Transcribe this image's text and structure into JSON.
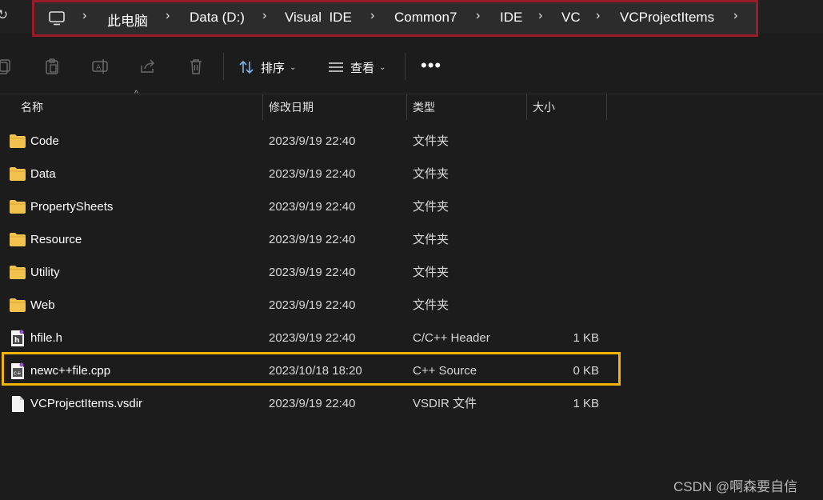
{
  "address_bar": {
    "crumbs": [
      "此电脑",
      "Data (D:)",
      "Visual  IDE",
      "Common7",
      "IDE",
      "VC",
      "VCProjectItems"
    ]
  },
  "toolbar": {
    "sort_label": "排序",
    "view_label": "查看",
    "more_label": "•••"
  },
  "columns": {
    "name": "名称",
    "date": "修改日期",
    "type": "类型",
    "size": "大小"
  },
  "files": [
    {
      "name": "Code",
      "date": "2023/9/19 22:40",
      "type": "文件夹",
      "size": "",
      "icon": "folder-icon"
    },
    {
      "name": "Data",
      "date": "2023/9/19 22:40",
      "type": "文件夹",
      "size": "",
      "icon": "folder-icon"
    },
    {
      "name": "PropertySheets",
      "date": "2023/9/19 22:40",
      "type": "文件夹",
      "size": "",
      "icon": "folder-icon"
    },
    {
      "name": "Resource",
      "date": "2023/9/19 22:40",
      "type": "文件夹",
      "size": "",
      "icon": "folder-icon"
    },
    {
      "name": "Utility",
      "date": "2023/9/19 22:40",
      "type": "文件夹",
      "size": "",
      "icon": "folder-icon"
    },
    {
      "name": "Web",
      "date": "2023/9/19 22:40",
      "type": "文件夹",
      "size": "",
      "icon": "folder-icon"
    },
    {
      "name": "hfile.h",
      "date": "2023/9/19 22:40",
      "type": "C/C++ Header",
      "size": "1 KB",
      "icon": "header-file-icon"
    },
    {
      "name": "newc++file.cpp",
      "date": "2023/10/18 18:20",
      "type": "C++ Source",
      "size": "0 KB",
      "icon": "cpp-file-icon"
    },
    {
      "name": "VCProjectItems.vsdir",
      "date": "2023/9/19 22:40",
      "type": "VSDIR 文件",
      "size": "1 KB",
      "icon": "file-icon"
    }
  ],
  "watermark": "CSDN @啊森要自信",
  "colors": {
    "background": "#1c1c1c",
    "address_highlight": "#9b1b2a",
    "row_highlight": "#f3b300",
    "folder": "#f2c14e"
  }
}
